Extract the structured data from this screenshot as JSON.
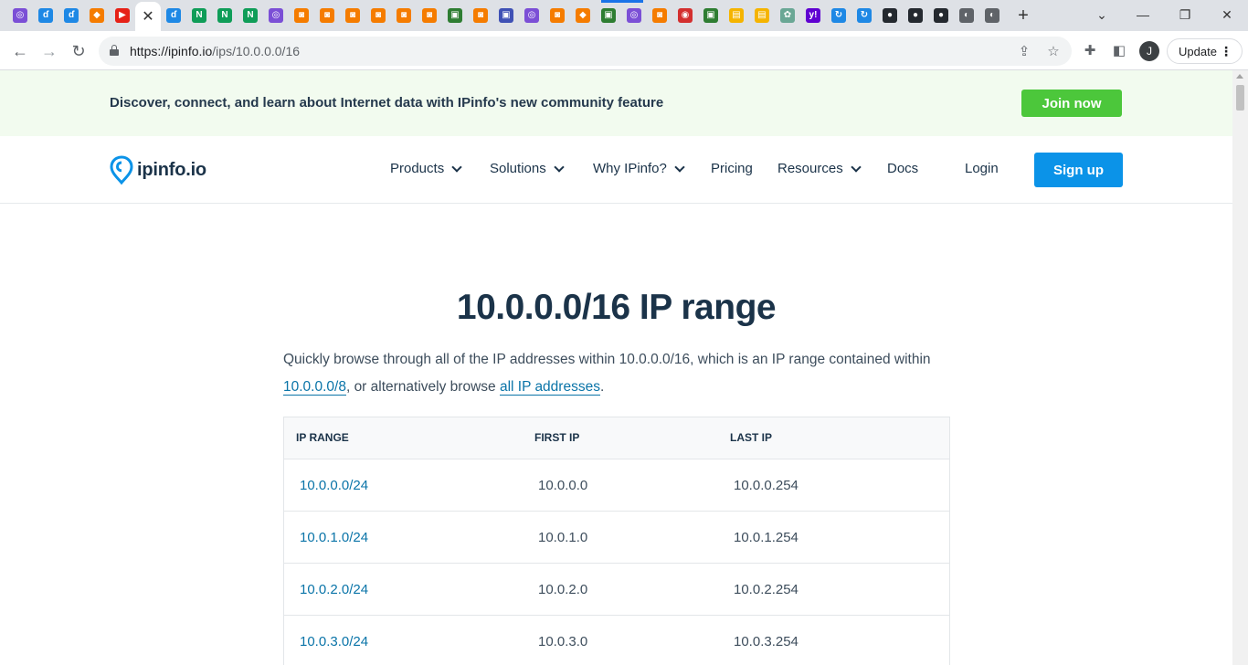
{
  "browser": {
    "tabs": [
      {
        "icon": "purple-app-icon",
        "color": "#7b4fd6",
        "glyph": "◎"
      },
      {
        "icon": "blue-swirl-icon",
        "color": "#1e88e5",
        "glyph": "ɗ"
      },
      {
        "icon": "blue-swirl-icon",
        "color": "#1e88e5",
        "glyph": "ɗ"
      },
      {
        "icon": "orange-cube-icon",
        "color": "#f57c00",
        "glyph": "◆"
      },
      {
        "icon": "youtube-icon",
        "color": "#e62117",
        "glyph": "▶"
      },
      {
        "icon": "active-tab-close-icon",
        "color": "#ffffff",
        "glyph": "✕"
      },
      {
        "icon": "blue-swirl-icon",
        "color": "#1e88e5",
        "glyph": "ɗ"
      },
      {
        "icon": "green-n-icon",
        "color": "#0f9d58",
        "glyph": "N"
      },
      {
        "icon": "green-n-icon",
        "color": "#0f9d58",
        "glyph": "N"
      },
      {
        "icon": "green-n-icon",
        "color": "#0f9d58",
        "glyph": "N"
      },
      {
        "icon": "purple-app-icon",
        "color": "#7b4fd6",
        "glyph": "◎"
      },
      {
        "icon": "orange-box-icon",
        "color": "#f57c00",
        "glyph": "◙"
      },
      {
        "icon": "orange-box-icon",
        "color": "#f57c00",
        "glyph": "◙"
      },
      {
        "icon": "orange-box-icon",
        "color": "#f57c00",
        "glyph": "◙"
      },
      {
        "icon": "orange-box-icon",
        "color": "#f57c00",
        "glyph": "◙"
      },
      {
        "icon": "orange-box-icon",
        "color": "#f57c00",
        "glyph": "◙"
      },
      {
        "icon": "orange-box-icon",
        "color": "#f57c00",
        "glyph": "◙"
      },
      {
        "icon": "green-grid-icon",
        "color": "#2e7d32",
        "glyph": "▣"
      },
      {
        "icon": "orange-box-icon",
        "color": "#f57c00",
        "glyph": "◙"
      },
      {
        "icon": "blue-grid-icon",
        "color": "#3f51b5",
        "glyph": "▣"
      },
      {
        "icon": "purple-app-icon",
        "color": "#7b4fd6",
        "glyph": "◎"
      },
      {
        "icon": "orange-box-icon",
        "color": "#f57c00",
        "glyph": "◙"
      },
      {
        "icon": "orange-cube-icon",
        "color": "#f57c00",
        "glyph": "◆"
      },
      {
        "icon": "green-grid-icon",
        "color": "#2e7d32",
        "glyph": "▣"
      },
      {
        "icon": "purple-app-icon",
        "color": "#7b4fd6",
        "glyph": "◎"
      },
      {
        "icon": "orange-box-icon",
        "color": "#f57c00",
        "glyph": "◙"
      },
      {
        "icon": "red-circle-icon",
        "color": "#d32f2f",
        "glyph": "◉"
      },
      {
        "icon": "green-grid-icon",
        "color": "#2e7d32",
        "glyph": "▣"
      },
      {
        "icon": "yellow-box-icon",
        "color": "#f5b400",
        "glyph": "▤"
      },
      {
        "icon": "yellow-box-icon",
        "color": "#f5b400",
        "glyph": "▤"
      },
      {
        "icon": "openai-icon",
        "color": "#6aa795",
        "glyph": "✿"
      },
      {
        "icon": "yahoo-icon",
        "color": "#5f01d1",
        "glyph": "y!"
      },
      {
        "icon": "blue-refresh-icon",
        "color": "#1e88e5",
        "glyph": "↻"
      },
      {
        "icon": "blue-refresh-icon",
        "color": "#1e88e5",
        "glyph": "↻"
      },
      {
        "icon": "github-icon",
        "color": "#24292f",
        "glyph": "●"
      },
      {
        "icon": "github-icon",
        "color": "#24292f",
        "glyph": "●"
      },
      {
        "icon": "github-icon",
        "color": "#24292f",
        "glyph": "●"
      },
      {
        "icon": "globe-icon",
        "color": "#5f6368",
        "glyph": "◐"
      },
      {
        "icon": "globe-icon",
        "color": "#5f6368",
        "glyph": "◐"
      }
    ],
    "url_host": "https://ipinfo.io",
    "url_path": "/ips/10.0.0.0/16",
    "avatar_letter": "J",
    "update_label": "Update"
  },
  "banner": {
    "text": "Discover, connect, and learn about Internet data with IPinfo's new community feature",
    "button": "Join now"
  },
  "nav": {
    "logo": "ipinfo.io",
    "items": [
      {
        "label": "Products",
        "dropdown": true
      },
      {
        "label": "Solutions",
        "dropdown": true
      },
      {
        "label": "Why IPinfo?",
        "dropdown": true
      },
      {
        "label": "Pricing",
        "dropdown": false
      },
      {
        "label": "Resources",
        "dropdown": true
      },
      {
        "label": "Docs",
        "dropdown": false
      }
    ],
    "login": "Login",
    "signup": "Sign up"
  },
  "main": {
    "title": "10.0.0.0/16 IP range",
    "intro_part1": "Quickly browse through all of the IP addresses within 10.0.0.0/16, which is an IP range contained within",
    "intro_link1": "10.0.0.0/8",
    "intro_part2": ", or alternatively browse ",
    "intro_link2": "all IP addresses",
    "intro_part3": "."
  },
  "table": {
    "headers": [
      "IP RANGE",
      "FIRST IP",
      "LAST IP"
    ],
    "rows": [
      {
        "range": "10.0.0.0/24",
        "first": "10.0.0.0",
        "last": "10.0.0.254"
      },
      {
        "range": "10.0.1.0/24",
        "first": "10.0.1.0",
        "last": "10.0.1.254"
      },
      {
        "range": "10.0.2.0/24",
        "first": "10.0.2.0",
        "last": "10.0.2.254"
      },
      {
        "range": "10.0.3.0/24",
        "first": "10.0.3.0",
        "last": "10.0.3.254"
      }
    ]
  }
}
